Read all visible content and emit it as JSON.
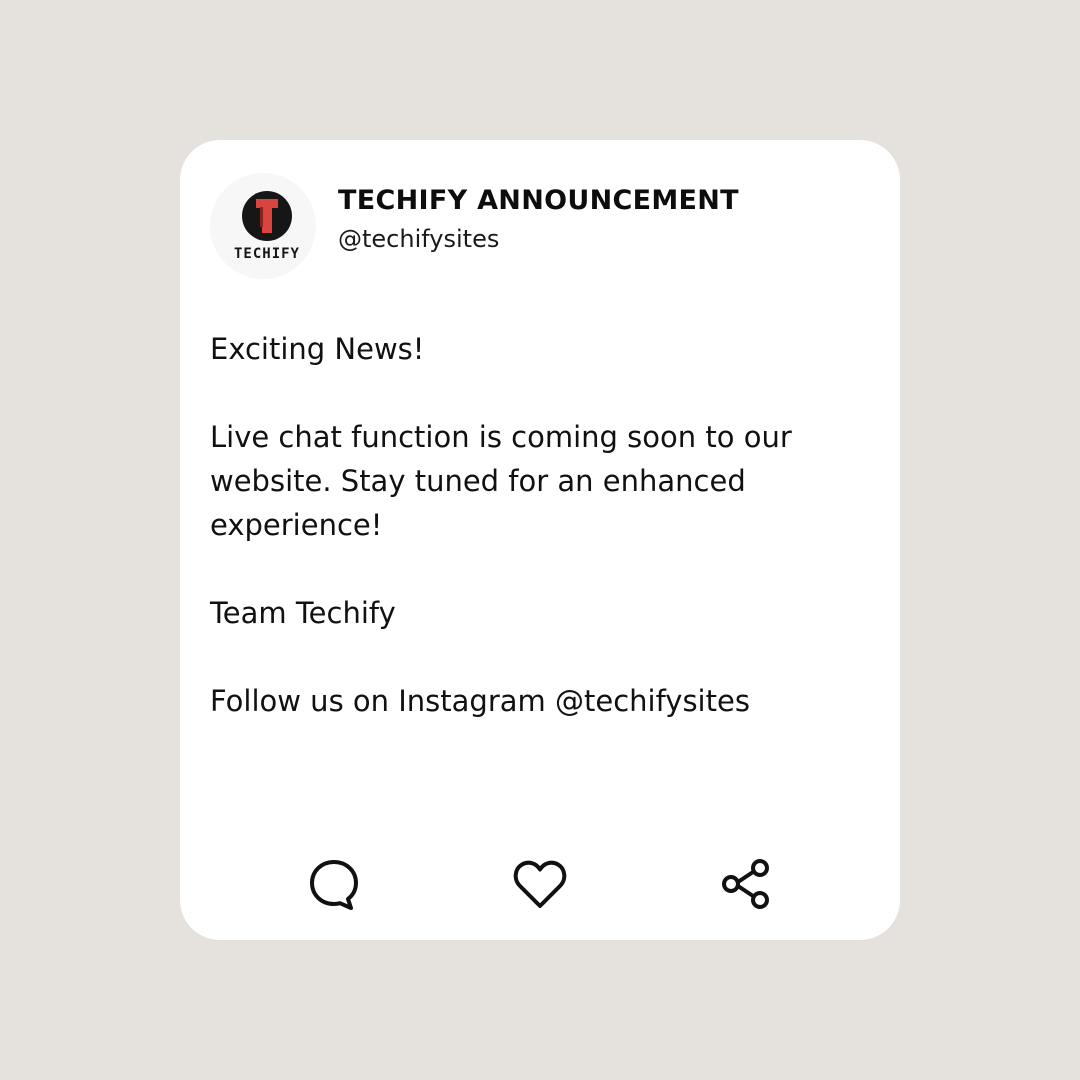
{
  "post": {
    "account_name": "TECHIFY ANNOUNCEMENT",
    "handle": "@techifysites",
    "avatar": {
      "logo_letter": "T",
      "logo_text": "TECHIFY",
      "logo_colors": {
        "circle": "#1a1a1a",
        "letter": "#d9443f"
      }
    },
    "paragraphs": [
      "Exciting News!",
      "Live chat function is coming soon to our website. Stay tuned for an enhanced experience!",
      "Team Techify",
      "Follow us on Instagram @techifysites"
    ]
  },
  "actions": [
    {
      "name": "comment",
      "icon": "comment-icon"
    },
    {
      "name": "like",
      "icon": "heart-icon"
    },
    {
      "name": "share",
      "icon": "share-icon"
    }
  ],
  "colors": {
    "background": "#e5e2de",
    "card": "#ffffff",
    "text": "#111111"
  }
}
